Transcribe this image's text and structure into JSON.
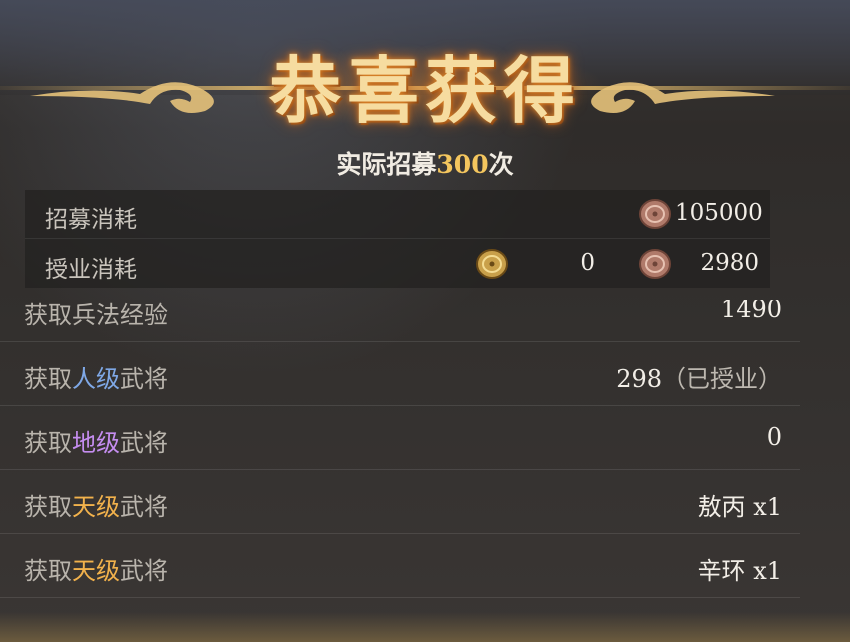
{
  "header": {
    "title": "恭喜获得",
    "subtitle_prefix": "实际招募",
    "subtitle_count": "300",
    "subtitle_suffix": "次"
  },
  "costs": [
    {
      "label": "招募消耗",
      "items": [
        {
          "icon": "copper-coin-icon",
          "value": "105000"
        }
      ]
    },
    {
      "label": "授业消耗",
      "items": [
        {
          "icon": "gold-coin-icon",
          "value": "0"
        },
        {
          "icon": "copper-coin-icon",
          "value": "2980"
        }
      ]
    }
  ],
  "rows": [
    {
      "label_prefix": "获取",
      "quality": "",
      "label_suffix": "兵法经验",
      "value": "1490",
      "paren": ""
    },
    {
      "label_prefix": "获取",
      "quality": "人级",
      "label_suffix": "武将",
      "value": "298",
      "paren": "（已授业）"
    },
    {
      "label_prefix": "获取",
      "quality": "地级",
      "label_suffix": "武将",
      "value": "0",
      "paren": ""
    },
    {
      "label_prefix": "获取",
      "quality": "天级",
      "label_suffix": "武将",
      "value": "敖丙 x1",
      "paren": ""
    },
    {
      "label_prefix": "获取",
      "quality": "天级",
      "label_suffix": "武将",
      "value": "辛环 x1",
      "paren": ""
    }
  ],
  "colors": {
    "title_gold": "#f6dca0",
    "count_gold": "#f4c65e",
    "quality_ren": "#7fa8e6",
    "quality_di": "#c58df0",
    "quality_tian": "#f2b24c"
  }
}
